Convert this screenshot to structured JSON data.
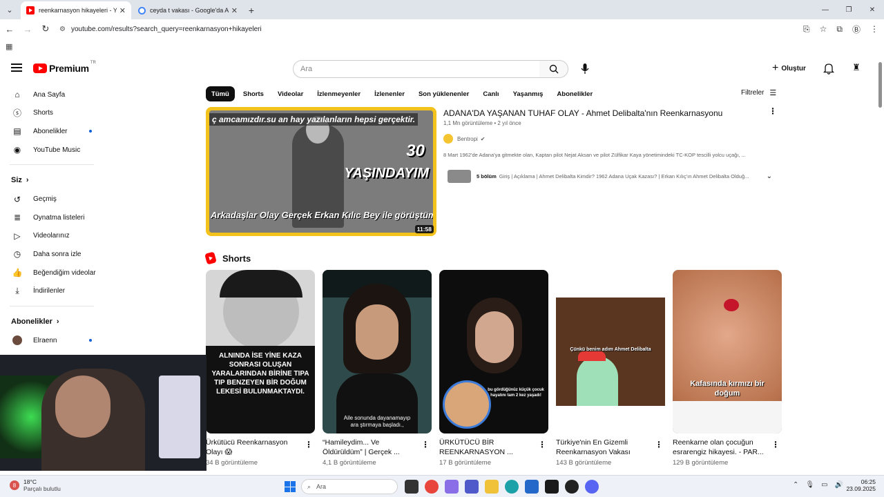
{
  "browser": {
    "tabs": [
      {
        "title": "reenkarnasyon hikayeleri - YouTube",
        "active": true
      },
      {
        "title": "ceyda t vakası - Google'da Ara",
        "active": false
      }
    ],
    "url": "youtube.com/results?search_query=reenkarnasyon+hikayeleri"
  },
  "header": {
    "logo_text": "Premium",
    "country": "TR",
    "search_placeholder": "Ara",
    "create_label": "Oluştur"
  },
  "sidebar": {
    "main": [
      {
        "label": "Ana Sayfa",
        "icon": "home-icon"
      },
      {
        "label": "Shorts",
        "icon": "shorts-icon"
      },
      {
        "label": "Abonelikler",
        "icon": "subscriptions-icon",
        "dot": true
      },
      {
        "label": "YouTube Music",
        "icon": "music-icon"
      }
    ],
    "you_heading": "Siz",
    "you": [
      {
        "label": "Geçmiş",
        "icon": "history-icon"
      },
      {
        "label": "Oynatma listeleri",
        "icon": "playlist-icon"
      },
      {
        "label": "Videolarınız",
        "icon": "your-videos-icon"
      },
      {
        "label": "Daha sonra izle",
        "icon": "watch-later-icon"
      },
      {
        "label": "Beğendiğim videolar",
        "icon": "like-icon"
      },
      {
        "label": "İndirilenler",
        "icon": "download-icon"
      }
    ],
    "subs_heading": "Abonelikler",
    "subs": [
      {
        "label": "Elraenn",
        "dot": true
      }
    ]
  },
  "chips": [
    "Tümü",
    "Shorts",
    "Videolar",
    "İzlenmeyenler",
    "İzlenenler",
    "Son yüklenenler",
    "Canlı",
    "Yaşanmış",
    "Abonelikler"
  ],
  "filters_label": "Filtreler",
  "main_video": {
    "title": "ADANA'DA YAŞANAN TUHAF OLAY - Ahmet Delibalta'nın Reenkarnasyonu",
    "views": "1,1 Mn görüntüleme",
    "age": "2 yıl önce",
    "channel": "Bentropi",
    "description": "8 Mart 1962'de Adana'ya gitmekte olan, Kaptan pilot Nejat Aksan ve pilot Zülfikar Kaya yönetimindeki TC-KOP tescilli yolcu uçağı, ...",
    "chapters_count": "5 bölüm",
    "chapters_text": "Giriş | Açıklama | Ahmet Delibalta Kimdir? 1962 Adana Uçak Kazası? | Erkan Kılıç'ın Ahmet Delibalta Olduğ...",
    "duration": "11:58",
    "thumb_text": {
      "top": "ç amcamızdır.su an hay    yazılanların hepsi gerçektir.",
      "number": "30",
      "word": "YAŞINDAYIM",
      "bottom": "Arkadaşlar Olay Gerçek Erkan Kılıc Bey ile görüştüm."
    }
  },
  "shorts_heading": "Shorts",
  "shorts": [
    {
      "title": "Ürkütücü Reenkarnasyon Olayı 😱",
      "views": "34 B görüntüleme",
      "caption": "ALNINDA İSE YİNE KAZA SONRASI OLUŞAN YARALARINDAN BİRİNE TIPA TIP BENZEYEN BİR DOĞUM LEKESİ BULUNMAKTAYDI."
    },
    {
      "title": "“Hamileydim... Ve Öldürüldüm” | Gerçek ...",
      "views": "4,1 B görüntüleme",
      "caption": "Aile sonunda dayanamayıp ara ştırmaya başladı.,"
    },
    {
      "title": "ÜRKÜTÜCÜ BİR REENKARNASYON ...",
      "views": "17 B görüntüleme",
      "caption": "bu gördüğünüz küçük çocuk hayatını tam 2 kez yaşadı!"
    },
    {
      "title": "Türkiye'nin En Gizemli Reenkarnasyon Vakası",
      "views": "143 B görüntüleme",
      "caption": "Çünkü benim adım Ahmet Delibalta"
    },
    {
      "title": "Reenkarne olan çocuğun esrarengiz hikayesi. - PAR...",
      "views": "129 B görüntüleme",
      "caption": "Kafasında kırmızı bir doğum"
    }
  ],
  "taskbar": {
    "temp": "18°C",
    "weather": "Parçalı bulutlu",
    "weather_badge": "8",
    "search": "Ara",
    "time": "06:25",
    "date": "23.09.2025"
  }
}
